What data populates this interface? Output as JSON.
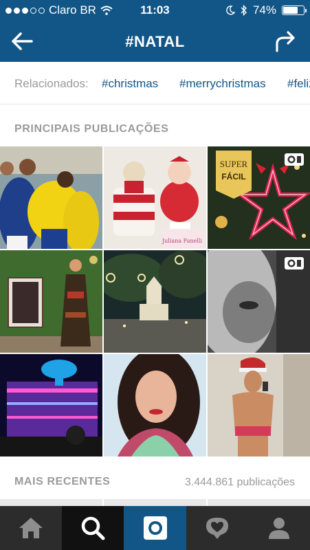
{
  "status_bar": {
    "carrier": "Claro BR",
    "time": "11:03",
    "battery_percent": "74%",
    "battery_level": 0.74,
    "signal_bars_filled": 3,
    "signal_bars_total": 5
  },
  "header": {
    "title": "#NATAL",
    "back_icon": "arrow-left-icon",
    "share_icon": "share-arrow-icon"
  },
  "related": {
    "label": "Relacionados:",
    "tags": [
      "#christmas",
      "#merrychristmas",
      "#feliz"
    ]
  },
  "top_posts": {
    "title": "PRINCIPAIS PUBLICAÇÕES",
    "posts": [
      {
        "id": "soccer-team",
        "video": false
      },
      {
        "id": "christmas-cake-baby",
        "video": false,
        "overlay_text": "Juliana Fanelli"
      },
      {
        "id": "super-facil-star",
        "video": true,
        "overlay_text": "SUPER FÁCIL"
      },
      {
        "id": "dress-green-wall",
        "video": false
      },
      {
        "id": "church-night-square",
        "video": false
      },
      {
        "id": "woman-bw-closeup",
        "video": true
      },
      {
        "id": "lit-building-night",
        "video": false
      },
      {
        "id": "woman-portrait",
        "video": false
      },
      {
        "id": "santa-hat-selfie",
        "video": false
      }
    ]
  },
  "recent": {
    "title": "MAIS RECENTES",
    "count": "3.444.861 publicações"
  },
  "bottom_nav": [
    {
      "name": "home-icon",
      "active": false
    },
    {
      "name": "search-icon",
      "active": true
    },
    {
      "name": "camera-icon",
      "active": false
    },
    {
      "name": "activity-heart-icon",
      "active": false
    },
    {
      "name": "profile-icon",
      "active": false
    }
  ],
  "colors": {
    "brand_blue": "#125688",
    "nav_dark": "#2c2c2c",
    "muted_text": "#9a9a9a"
  }
}
